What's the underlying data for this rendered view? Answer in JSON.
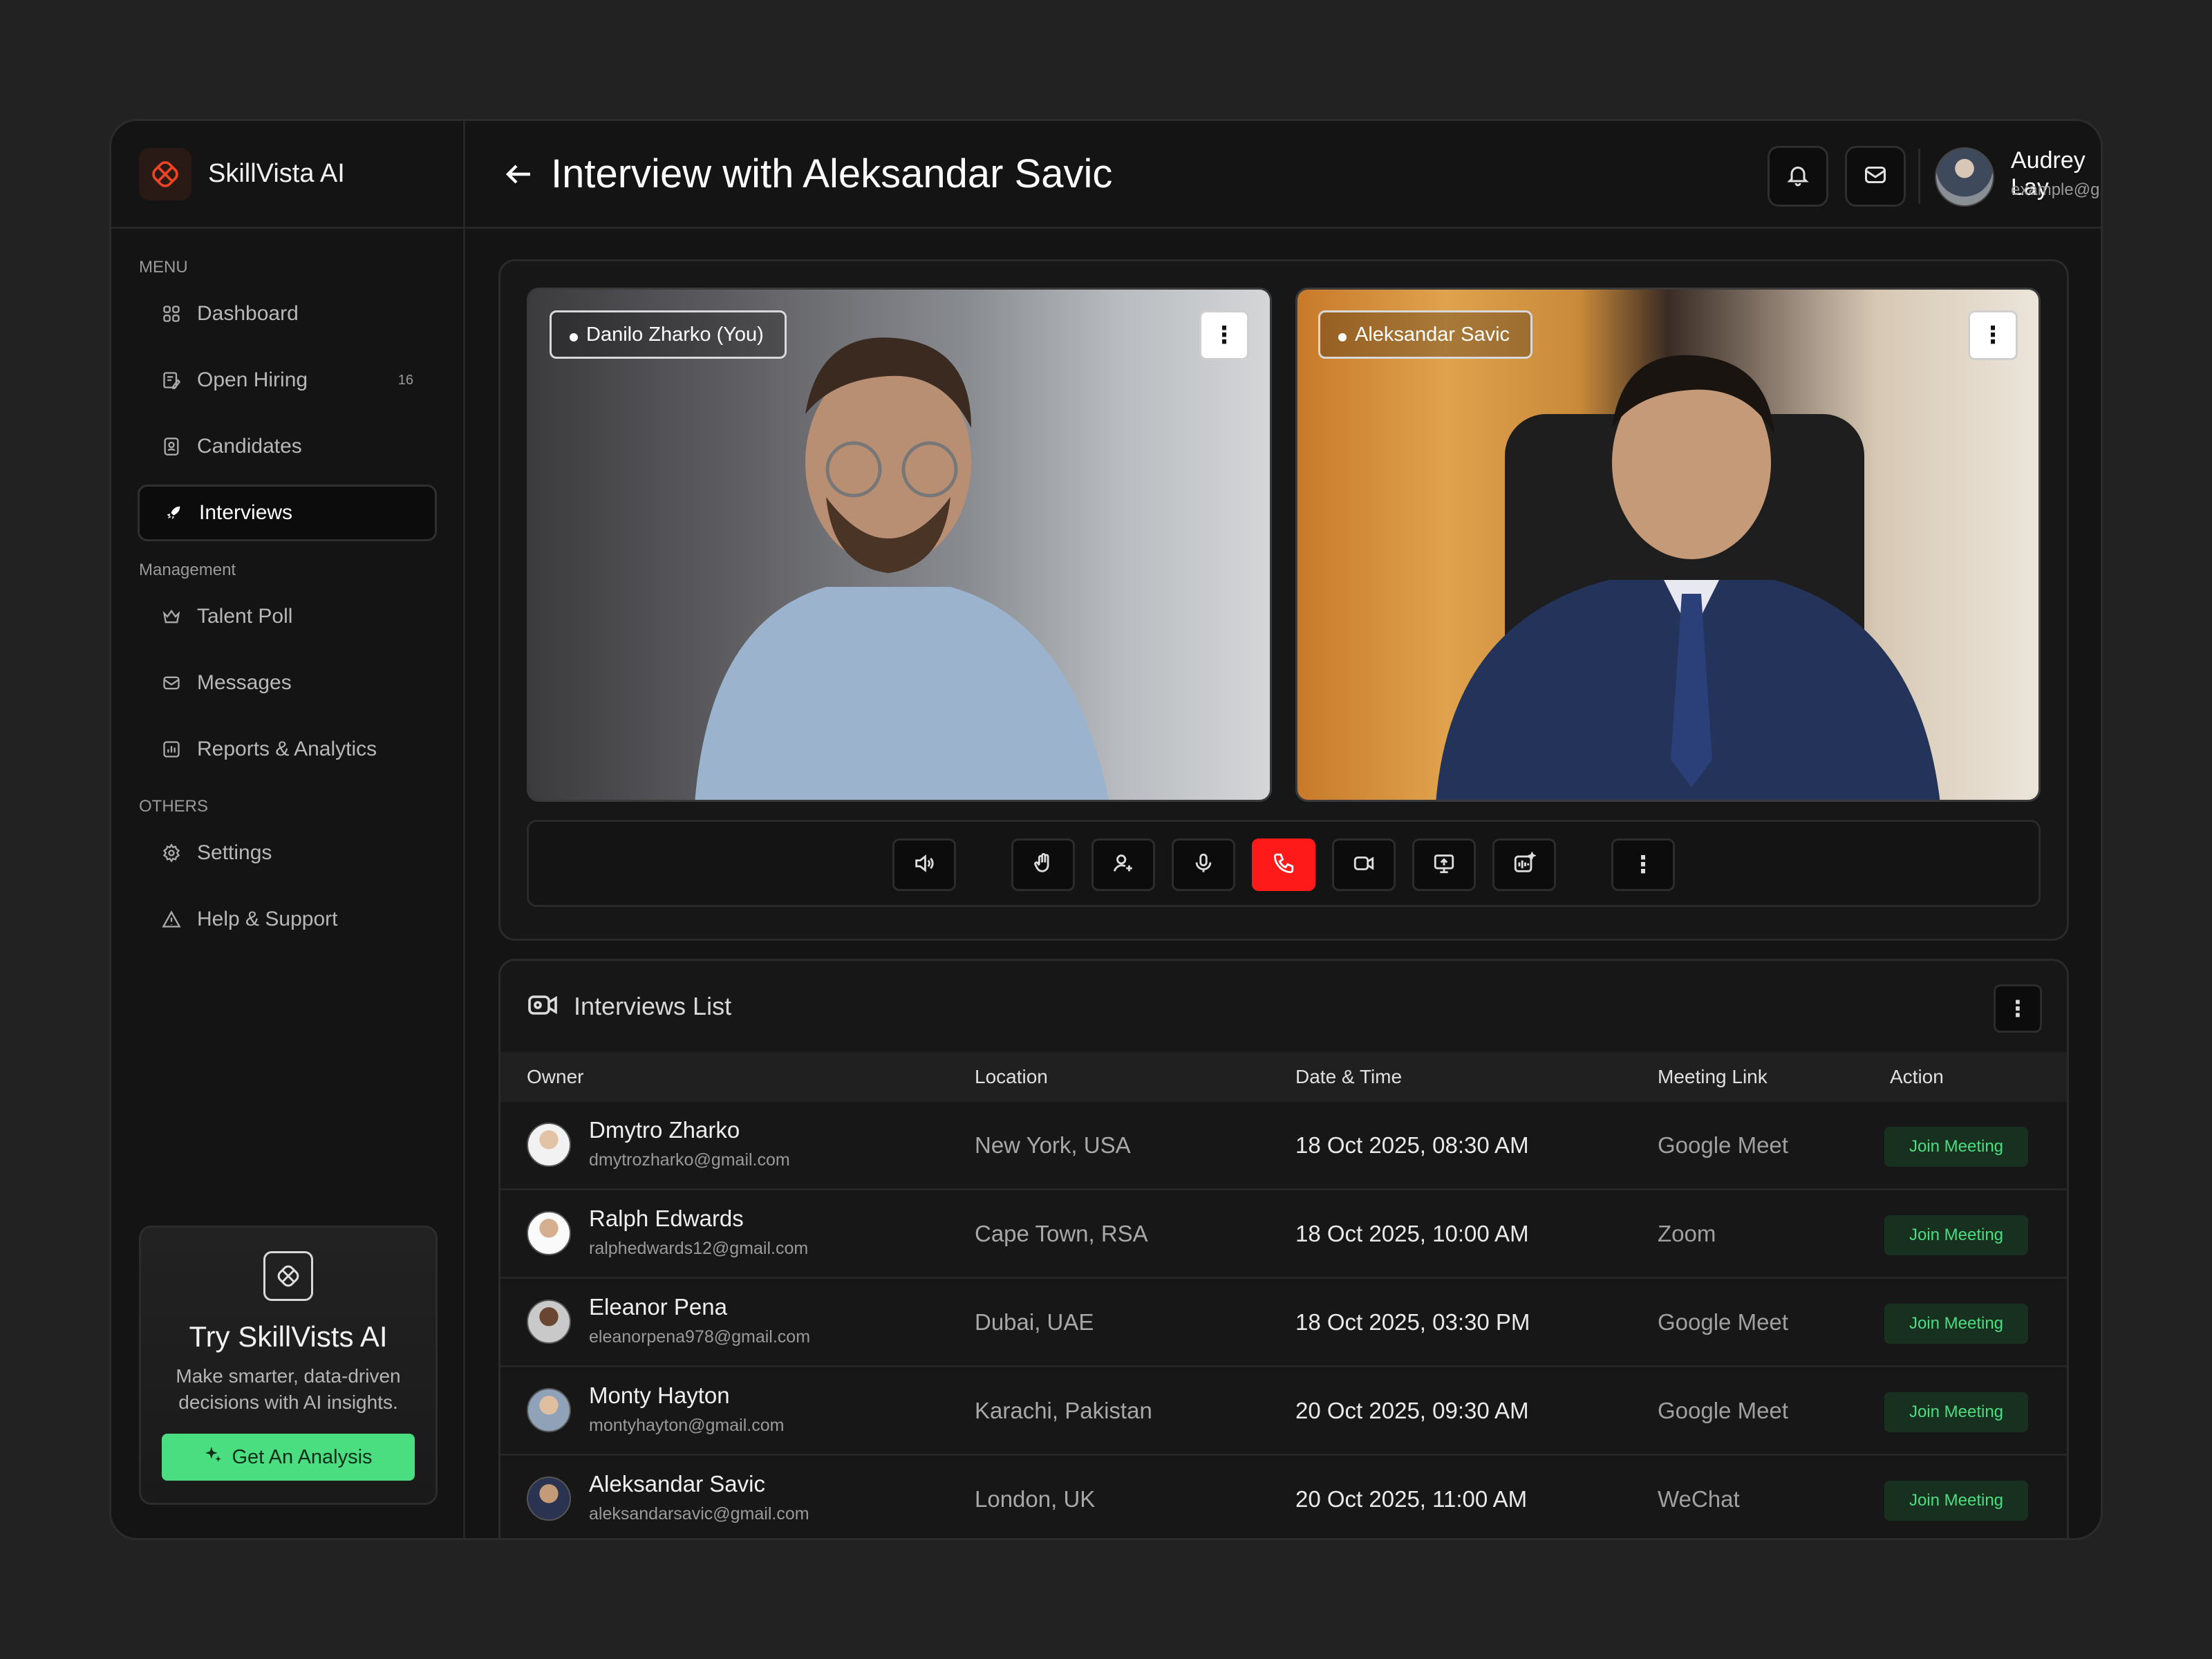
{
  "app": {
    "name": "SkillVista AI",
    "accent": "#ef4423"
  },
  "sidebar": {
    "sections": [
      {
        "label": "MENU"
      },
      {
        "label": "Management"
      },
      {
        "label": "OTHERS"
      }
    ],
    "items": [
      {
        "label": "Dashboard",
        "icon": "grid-icon"
      },
      {
        "label": "Open Hiring",
        "icon": "edit-icon",
        "badge": "16"
      },
      {
        "label": "Candidates",
        "icon": "contacts-icon"
      },
      {
        "label": "Interviews",
        "icon": "rocket-icon",
        "active": true
      },
      {
        "label": "Talent Poll",
        "icon": "crown-icon"
      },
      {
        "label": "Messages",
        "icon": "mail-icon"
      },
      {
        "label": "Reports & Analytics",
        "icon": "chart-icon"
      },
      {
        "label": "Settings",
        "icon": "gear-icon"
      },
      {
        "label": "Help & Support",
        "icon": "warning-icon"
      }
    ],
    "promo": {
      "title": "Try SkillVists AI",
      "description": "Make smarter, data-driven decisions with AI insights.",
      "button": "Get An Analysis"
    }
  },
  "header": {
    "title": "Interview with Aleksandar Savic",
    "user": {
      "name": "Audrey Lay",
      "email": "example@gmail.com"
    }
  },
  "call": {
    "participants": [
      {
        "label": "Danilo Zharko (You)"
      },
      {
        "label": "Aleksandar Savic"
      }
    ],
    "controls": [
      "speaker-icon",
      "raise-hand-icon",
      "add-user-icon",
      "microphone-icon",
      "end-call-icon",
      "camera-icon",
      "screen-share-icon",
      "audio-wave-icon",
      "more-icon"
    ],
    "end_call_color": "#ff1a1a"
  },
  "interviews": {
    "title": "Interviews List",
    "columns": [
      "Owner",
      "Location",
      "Date & Time",
      "Meeting Link",
      "Action"
    ],
    "rows": [
      {
        "name": "Dmytro Zharko",
        "email": "dmytrozharko@gmail.com",
        "location": "New York, USA",
        "datetime": "18 Oct 2025, 08:30 AM",
        "link": "Google Meet",
        "action": "Join Meeting"
      },
      {
        "name": "Ralph Edwards",
        "email": "ralphedwards12@gmail.com",
        "location": "Cape Town, RSA",
        "datetime": "18 Oct 2025, 10:00 AM",
        "link": "Zoom",
        "action": "Join Meeting"
      },
      {
        "name": "Eleanor Pena",
        "email": "eleanorpena978@gmail.com",
        "location": "Dubai, UAE",
        "datetime": "18 Oct 2025, 03:30 PM",
        "link": "Google Meet",
        "action": "Join Meeting"
      },
      {
        "name": "Monty Hayton",
        "email": "montyhayton@gmail.com",
        "location": "Karachi, Pakistan",
        "datetime": "20 Oct 2025, 09:30 AM",
        "link": "Google Meet",
        "action": "Join Meeting"
      },
      {
        "name": "Aleksandar Savic",
        "email": "aleksandarsavic@gmail.com",
        "location": "London, UK",
        "datetime": "20 Oct 2025, 11:00 AM",
        "link": "WeChat",
        "action": "Join Meeting"
      }
    ],
    "action_color": "#4ade80"
  }
}
